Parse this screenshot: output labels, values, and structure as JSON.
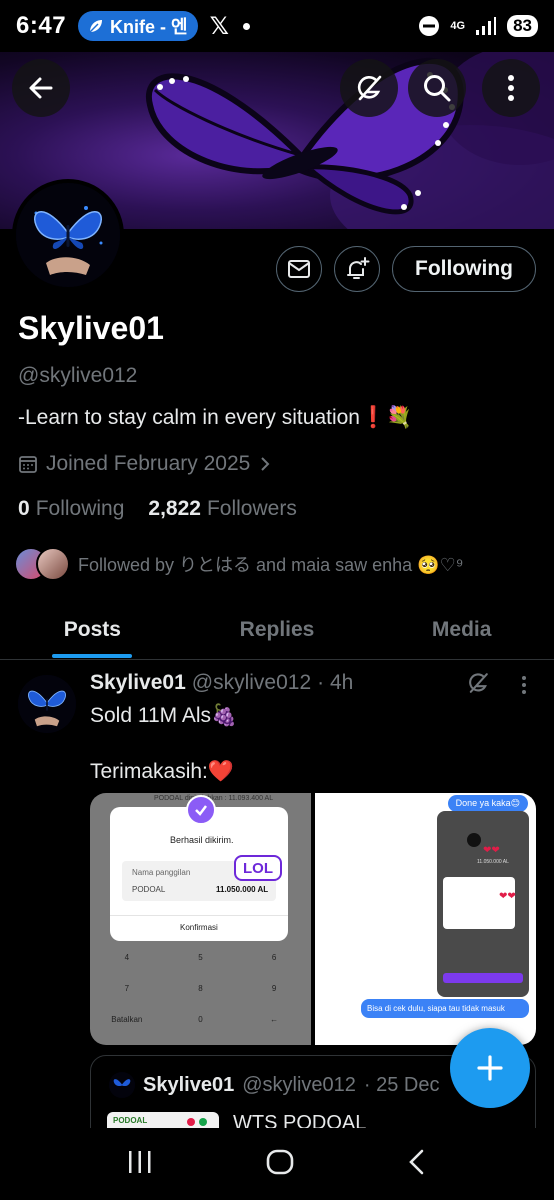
{
  "status_bar": {
    "time": "6:47",
    "app_pill": "Knife - 엔",
    "x_app": "𝕏",
    "network": "4G",
    "battery": "83"
  },
  "profile": {
    "name": "Skylive01",
    "handle": "@skylive012",
    "bio": "-Learn to stay calm in every situation❗💐",
    "joined": "Joined February 2025",
    "following_count": "0",
    "following_label": "Following",
    "followers_count": "2,822",
    "followers_label": "Followers",
    "followed_by": "Followed by りとはる and maia saw enha 🥺♡⁹",
    "follow_button": "Following"
  },
  "tabs": [
    "Posts",
    "Replies",
    "Media"
  ],
  "post": {
    "name": "Skylive01",
    "handle": "@skylive012",
    "time": "· 4h",
    "line1": "Sold 11M Als🍇",
    "line2": "Terimakasih:❤️",
    "media_left": {
      "top_text": "PODOAL  dipindahkan : 11.093.400 AL",
      "dialog_title": "Berhasil dikirim.",
      "field_label": "Nama panggilan",
      "field_name": "PODOAL",
      "field_amount": "11.050.000 AL",
      "confirm": "Konfirmasi",
      "sticker": "LOL",
      "keys": [
        "4",
        "5",
        "6",
        "7",
        "8",
        "9",
        "Batalkan",
        "0",
        "←"
      ]
    },
    "media_right": {
      "bubble_top": "Done ya kaka😊",
      "inner_amount": "11.050.000 AL",
      "bubble_bottom": "Bisa di cek dulu, siapa tau tidak masuk"
    },
    "quote": {
      "name": "Skylive01",
      "handle": "@skylive012",
      "time": "· 25 Dec",
      "text": "WTS PODOAL",
      "thumb_label": "PODOAL"
    }
  },
  "colors": {
    "accent": "#1d9bf0",
    "muted": "#71767b",
    "border": "#2f3336",
    "purple": "#7c3aed"
  }
}
